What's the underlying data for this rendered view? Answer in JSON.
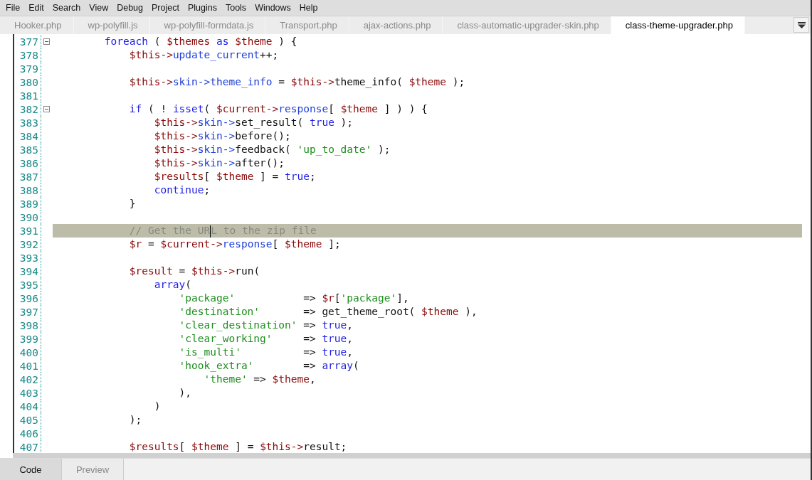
{
  "menu": [
    "File",
    "Edit",
    "Search",
    "View",
    "Debug",
    "Project",
    "Plugins",
    "Tools",
    "Windows",
    "Help"
  ],
  "tabs": [
    {
      "label": "Hooker.php",
      "selected": false
    },
    {
      "label": "wp-polyfill.js",
      "selected": false
    },
    {
      "label": "wp-polyfill-formdata.js",
      "selected": false
    },
    {
      "label": "Transport.php",
      "selected": false
    },
    {
      "label": "ajax-actions.php",
      "selected": false
    },
    {
      "label": "class-automatic-upgrader-skin.php",
      "selected": false
    },
    {
      "label": "class-theme-upgrader.php",
      "selected": true
    }
  ],
  "lines": [
    {
      "number": "377",
      "fold": true,
      "highlighted": false,
      "tokens": [
        {
          "kind": "kw",
          "text": "        foreach"
        },
        {
          "kind": "plain",
          "text": " ( "
        },
        {
          "kind": "var",
          "text": "$themes"
        },
        {
          "kind": "kw",
          "text": " as "
        },
        {
          "kind": "var",
          "text": "$theme"
        },
        {
          "kind": "plain",
          "text": " ) {"
        }
      ]
    },
    {
      "number": "378",
      "fold": false,
      "highlighted": false,
      "tokens": [
        {
          "kind": "var",
          "text": "            $this->"
        },
        {
          "kind": "prop",
          "text": "update_current"
        },
        {
          "kind": "plain",
          "text": "++;"
        }
      ]
    },
    {
      "number": "379",
      "fold": false,
      "highlighted": false
    },
    {
      "number": "380",
      "fold": false,
      "highlighted": false,
      "tokens": [
        {
          "kind": "var",
          "text": "            $this->"
        },
        {
          "kind": "prop",
          "text": "skin->theme_info"
        },
        {
          "kind": "plain",
          "text": " = "
        },
        {
          "kind": "var",
          "text": "$this->"
        },
        {
          "kind": "plain",
          "text": "theme_info( "
        },
        {
          "kind": "var",
          "text": "$theme"
        },
        {
          "kind": "plain",
          "text": " );"
        }
      ]
    },
    {
      "number": "381",
      "fold": false,
      "highlighted": false
    },
    {
      "number": "382",
      "fold": true,
      "highlighted": false,
      "tokens": [
        {
          "kind": "kw",
          "text": "            if"
        },
        {
          "kind": "plain",
          "text": " ( ! "
        },
        {
          "kind": "kw",
          "text": "isset"
        },
        {
          "kind": "plain",
          "text": "( "
        },
        {
          "kind": "var",
          "text": "$current->"
        },
        {
          "kind": "prop",
          "text": "response"
        },
        {
          "kind": "plain",
          "text": "[ "
        },
        {
          "kind": "var",
          "text": "$theme"
        },
        {
          "kind": "plain",
          "text": " ] ) ) {"
        }
      ]
    },
    {
      "number": "383",
      "fold": false,
      "highlighted": false,
      "tokens": [
        {
          "kind": "var",
          "text": "                $this->"
        },
        {
          "kind": "prop",
          "text": "skin->"
        },
        {
          "kind": "plain",
          "text": "set_result( "
        },
        {
          "kind": "kw",
          "text": "true"
        },
        {
          "kind": "plain",
          "text": " );"
        }
      ]
    },
    {
      "number": "384",
      "fold": false,
      "highlighted": false,
      "tokens": [
        {
          "kind": "var",
          "text": "                $this->"
        },
        {
          "kind": "prop",
          "text": "skin->"
        },
        {
          "kind": "plain",
          "text": "before();"
        }
      ]
    },
    {
      "number": "385",
      "fold": false,
      "highlighted": false,
      "tokens": [
        {
          "kind": "var",
          "text": "                $this->"
        },
        {
          "kind": "prop",
          "text": "skin->"
        },
        {
          "kind": "plain",
          "text": "feedback( "
        },
        {
          "kind": "str",
          "text": "'up_to_date'"
        },
        {
          "kind": "plain",
          "text": " );"
        }
      ]
    },
    {
      "number": "386",
      "fold": false,
      "highlighted": false,
      "tokens": [
        {
          "kind": "var",
          "text": "                $this->"
        },
        {
          "kind": "prop",
          "text": "skin->"
        },
        {
          "kind": "plain",
          "text": "after();"
        }
      ]
    },
    {
      "number": "387",
      "fold": false,
      "highlighted": false,
      "tokens": [
        {
          "kind": "var",
          "text": "                $results"
        },
        {
          "kind": "plain",
          "text": "[ "
        },
        {
          "kind": "var",
          "text": "$theme"
        },
        {
          "kind": "plain",
          "text": " ] = "
        },
        {
          "kind": "kw",
          "text": "true"
        },
        {
          "kind": "plain",
          "text": ";"
        }
      ]
    },
    {
      "number": "388",
      "fold": false,
      "highlighted": false,
      "tokens": [
        {
          "kind": "kw",
          "text": "                continue"
        },
        {
          "kind": "plain",
          "text": ";"
        }
      ]
    },
    {
      "number": "389",
      "fold": false,
      "highlighted": false,
      "tokens": [
        {
          "kind": "plain",
          "text": "            }"
        }
      ]
    },
    {
      "number": "390",
      "fold": false,
      "highlighted": false
    },
    {
      "number": "391",
      "fold": false,
      "highlighted": true,
      "tokens": [
        {
          "kind": "com",
          "text": "            // Get the UR"
        },
        {
          "kind": "caret"
        },
        {
          "kind": "com",
          "text": "L to the zip file"
        }
      ]
    },
    {
      "number": "392",
      "fold": false,
      "highlighted": false,
      "tokens": [
        {
          "kind": "var",
          "text": "            $r"
        },
        {
          "kind": "plain",
          "text": " = "
        },
        {
          "kind": "var",
          "text": "$current->"
        },
        {
          "kind": "prop",
          "text": "response"
        },
        {
          "kind": "plain",
          "text": "[ "
        },
        {
          "kind": "var",
          "text": "$theme"
        },
        {
          "kind": "plain",
          "text": " ];"
        }
      ]
    },
    {
      "number": "393",
      "fold": false,
      "highlighted": false
    },
    {
      "number": "394",
      "fold": false,
      "highlighted": false,
      "tokens": [
        {
          "kind": "var",
          "text": "            $result"
        },
        {
          "kind": "plain",
          "text": " = "
        },
        {
          "kind": "var",
          "text": "$this->"
        },
        {
          "kind": "plain",
          "text": "run("
        }
      ]
    },
    {
      "number": "395",
      "fold": false,
      "highlighted": false,
      "tokens": [
        {
          "kind": "kw",
          "text": "                array"
        },
        {
          "kind": "plain",
          "text": "("
        }
      ]
    },
    {
      "number": "396",
      "fold": false,
      "highlighted": false,
      "tokens": [
        {
          "kind": "str",
          "text": "                    'package'"
        },
        {
          "kind": "plain",
          "text": "           => "
        },
        {
          "kind": "var",
          "text": "$r"
        },
        {
          "kind": "plain",
          "text": "["
        },
        {
          "kind": "str",
          "text": "'package'"
        },
        {
          "kind": "plain",
          "text": "],"
        }
      ]
    },
    {
      "number": "397",
      "fold": false,
      "highlighted": false,
      "tokens": [
        {
          "kind": "str",
          "text": "                    'destination'"
        },
        {
          "kind": "plain",
          "text": "       => get_theme_root( "
        },
        {
          "kind": "var",
          "text": "$theme"
        },
        {
          "kind": "plain",
          "text": " ),"
        }
      ]
    },
    {
      "number": "398",
      "fold": false,
      "highlighted": false,
      "tokens": [
        {
          "kind": "str",
          "text": "                    'clear_destination'"
        },
        {
          "kind": "plain",
          "text": " => "
        },
        {
          "kind": "kw",
          "text": "true"
        },
        {
          "kind": "plain",
          "text": ","
        }
      ]
    },
    {
      "number": "399",
      "fold": false,
      "highlighted": false,
      "tokens": [
        {
          "kind": "str",
          "text": "                    'clear_working'"
        },
        {
          "kind": "plain",
          "text": "     => "
        },
        {
          "kind": "kw",
          "text": "true"
        },
        {
          "kind": "plain",
          "text": ","
        }
      ]
    },
    {
      "number": "400",
      "fold": false,
      "highlighted": false,
      "tokens": [
        {
          "kind": "str",
          "text": "                    'is_multi'"
        },
        {
          "kind": "plain",
          "text": "          => "
        },
        {
          "kind": "kw",
          "text": "true"
        },
        {
          "kind": "plain",
          "text": ","
        }
      ]
    },
    {
      "number": "401",
      "fold": false,
      "highlighted": false,
      "tokens": [
        {
          "kind": "str",
          "text": "                    'hook_extra'"
        },
        {
          "kind": "plain",
          "text": "        => "
        },
        {
          "kind": "kw",
          "text": "array"
        },
        {
          "kind": "plain",
          "text": "("
        }
      ]
    },
    {
      "number": "402",
      "fold": false,
      "highlighted": false,
      "tokens": [
        {
          "kind": "str",
          "text": "                        'theme'"
        },
        {
          "kind": "plain",
          "text": " => "
        },
        {
          "kind": "var",
          "text": "$theme"
        },
        {
          "kind": "plain",
          "text": ","
        }
      ]
    },
    {
      "number": "403",
      "fold": false,
      "highlighted": false,
      "tokens": [
        {
          "kind": "plain",
          "text": "                    ),"
        }
      ]
    },
    {
      "number": "404",
      "fold": false,
      "highlighted": false,
      "tokens": [
        {
          "kind": "plain",
          "text": "                )"
        }
      ]
    },
    {
      "number": "405",
      "fold": false,
      "highlighted": false,
      "tokens": [
        {
          "kind": "plain",
          "text": "            );"
        }
      ]
    },
    {
      "number": "406",
      "fold": false,
      "highlighted": false
    },
    {
      "number": "407",
      "fold": false,
      "highlighted": false,
      "tokens": [
        {
          "kind": "var",
          "text": "            $results"
        },
        {
          "kind": "plain",
          "text": "[ "
        },
        {
          "kind": "var",
          "text": "$theme"
        },
        {
          "kind": "plain",
          "text": " ] = "
        },
        {
          "kind": "var",
          "text": "$this->"
        },
        {
          "kind": "plain",
          "text": "result;"
        }
      ]
    }
  ],
  "bottom_tabs": [
    {
      "label": "Code",
      "selected": true
    },
    {
      "label": "Preview",
      "selected": false
    }
  ]
}
